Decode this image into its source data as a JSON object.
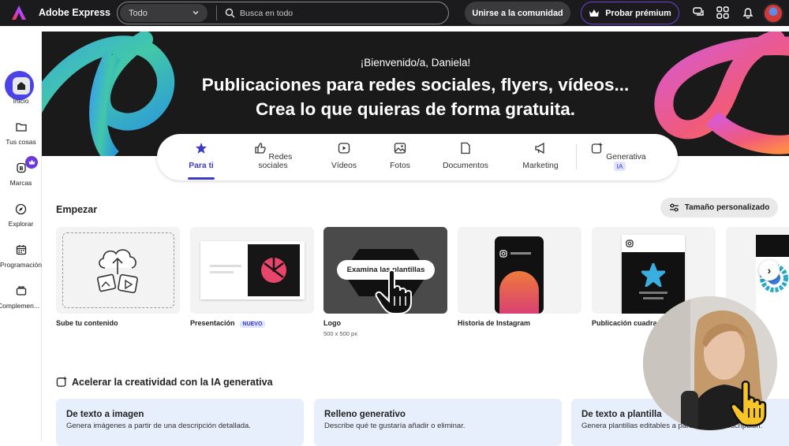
{
  "app": {
    "name": "Adobe Express"
  },
  "search": {
    "scope": "Todo",
    "placeholder": "Busca en todo"
  },
  "header": {
    "community_label": "Unirse a la comunidad",
    "premium_label": "Probar prémium"
  },
  "sidebar": {
    "items": [
      {
        "label": "Inicio",
        "icon": "home-icon"
      },
      {
        "label": "Tus cosas",
        "icon": "folder-icon"
      },
      {
        "label": "Marcas",
        "icon": "brand-icon"
      },
      {
        "label": "Explorar",
        "icon": "compass-icon"
      },
      {
        "label": "Programación",
        "icon": "calendar-icon"
      },
      {
        "label": "Complemen..."
      }
    ]
  },
  "hero": {
    "welcome": "¡Bienvenido/a, Daniela!",
    "title_line1": "Publicaciones para redes sociales, flyers, vídeos...",
    "title_line2": "Crea lo que quieras de forma gratuita."
  },
  "tabs": [
    {
      "label": "Para ti",
      "icon": "star-icon"
    },
    {
      "label": "Redes sociales",
      "icon": "thumbs-up-icon"
    },
    {
      "label": "Vídeos",
      "icon": "play-icon"
    },
    {
      "label": "Fotos",
      "icon": "image-icon"
    },
    {
      "label": "Documentos",
      "icon": "document-icon"
    },
    {
      "label": "Marketing",
      "icon": "megaphone-icon"
    },
    {
      "label": "Generativa",
      "badge": "IA",
      "icon": "sparkle-image-icon"
    }
  ],
  "start": {
    "title": "Empezar",
    "custom_size_label": "Tamaño personalizado",
    "cards": [
      {
        "label": "Sube tu contenido"
      },
      {
        "label": "Presentación",
        "badge": "NUEVO"
      },
      {
        "label": "Logo",
        "sub": "500 x 500 px",
        "tooltip": "Examina las plantillas"
      },
      {
        "label": "Historia de Instagram"
      },
      {
        "label": "Publicación cuadrada"
      }
    ]
  },
  "genai": {
    "title": "Acelerar la creatividad con la IA generativa",
    "cards": [
      {
        "title": "De texto a imagen",
        "desc": "Genera imágenes a partir de una descripción detallada."
      },
      {
        "title": "Relleno generativo",
        "desc": "Describe qué te gustaría añadir o eliminar."
      },
      {
        "title": "De texto a plantilla",
        "desc": "Genera plantillas editables a partir de una descripción."
      }
    ]
  },
  "colors": {
    "accent": "#3b3bc6",
    "new_button": "#4a44e8",
    "topbar": "#1b1b1d"
  }
}
